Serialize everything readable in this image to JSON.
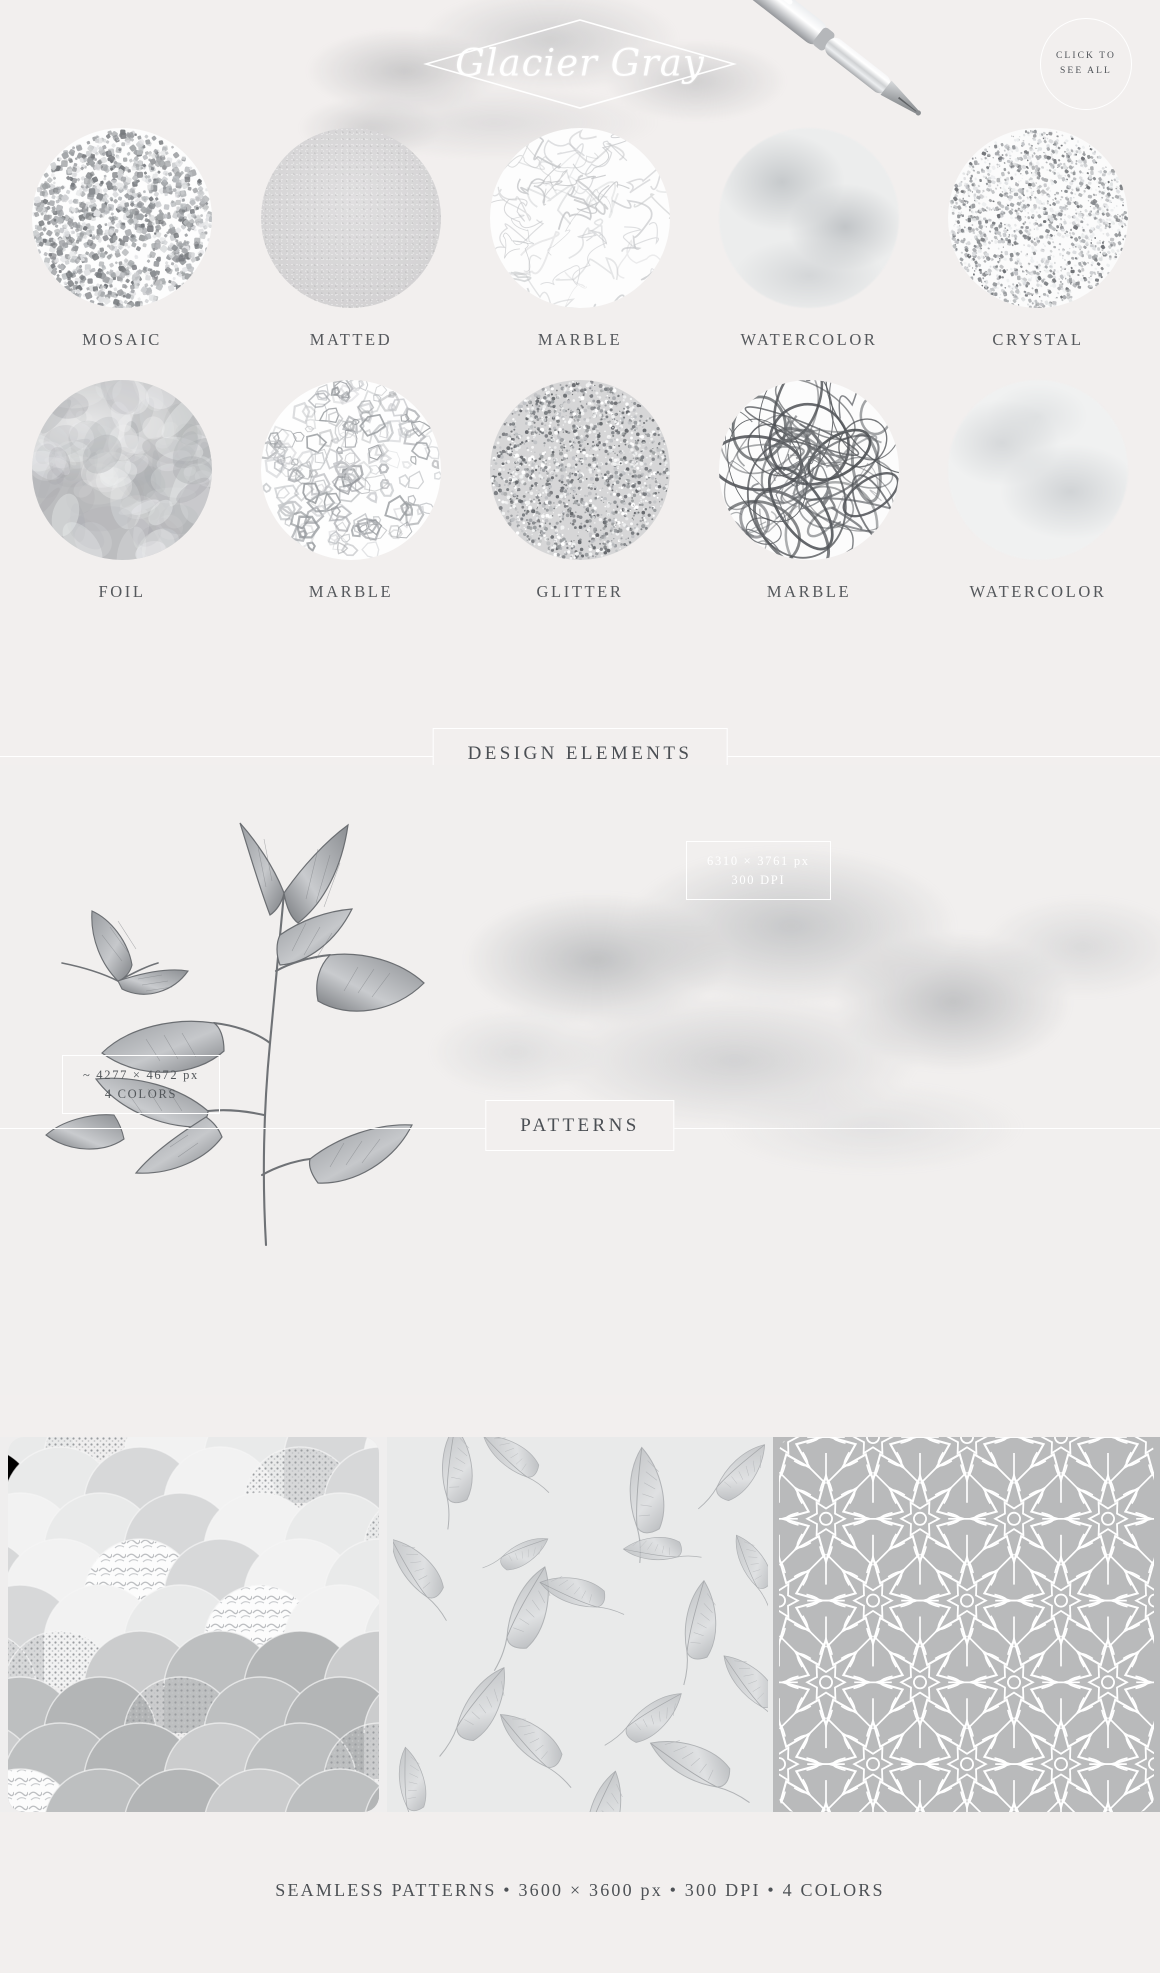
{
  "header": {
    "title": "Glacier Gray",
    "badge_line1": "CLICK TO",
    "badge_line2": "SEE ALL",
    "pen_icon": "fountain-pen"
  },
  "textures": {
    "row1": [
      {
        "label": "MOSAIC",
        "swatch": "mosaic"
      },
      {
        "label": "MATTED",
        "swatch": "matted"
      },
      {
        "label": "MARBLE",
        "swatch": "marble-light"
      },
      {
        "label": "WATERCOLOR",
        "swatch": "watercolor-soft"
      },
      {
        "label": "CRYSTAL",
        "swatch": "crystal-glitter"
      }
    ],
    "row2": [
      {
        "label": "FOIL",
        "swatch": "foil"
      },
      {
        "label": "MARBLE",
        "swatch": "marble-chunky"
      },
      {
        "label": "GLITTER",
        "swatch": "glitter"
      },
      {
        "label": "MARBLE",
        "swatch": "marble-swirl"
      },
      {
        "label": "WATERCOLOR",
        "swatch": "watercolor-pale"
      }
    ]
  },
  "sections": {
    "design_elements": "DESIGN ELEMENTS",
    "patterns": "PATTERNS"
  },
  "design": {
    "watercolor_dim_line1": "6310 × 3761 px",
    "watercolor_dim_line2": "300 DPI",
    "branch_dim_line1": "~ 4277 × 4672 px",
    "branch_dim_line2": "4 COLORS"
  },
  "patterns": {
    "items": [
      {
        "name": "scallop-fish-scale-pattern"
      },
      {
        "name": "botanical-leaves-pattern"
      },
      {
        "name": "geometric-lattice-pattern"
      }
    ],
    "footer": "SEAMLESS PATTERNS • 3600 × 3600 px • 300 DPI • 4 COLORS"
  },
  "colors": {
    "background": "#f2efee",
    "ink": "#4e5256",
    "rule": "#ffffff",
    "pattern_gray": "#b9babb"
  }
}
